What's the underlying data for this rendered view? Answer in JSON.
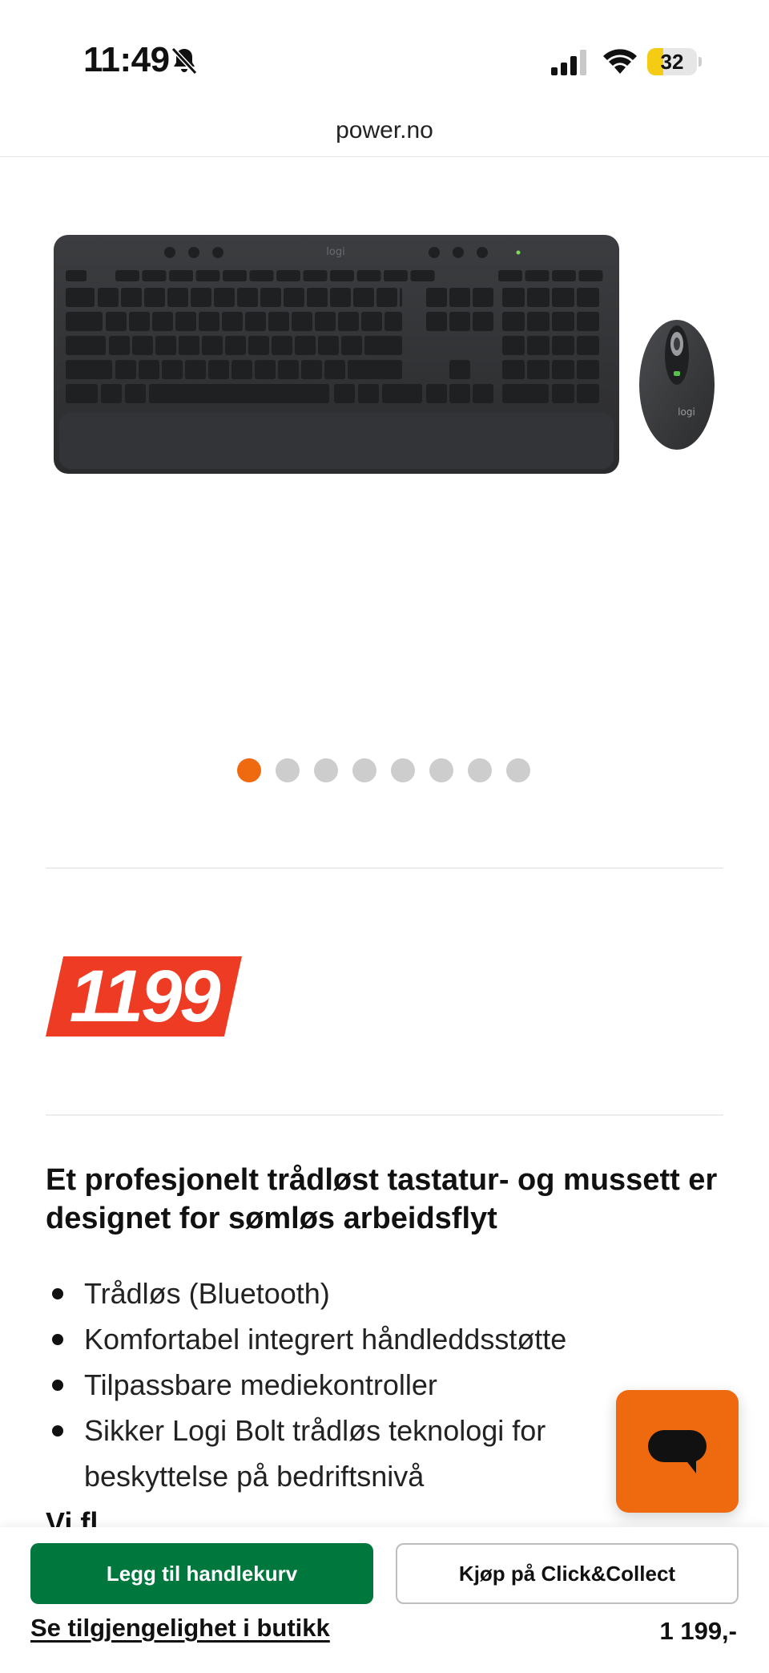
{
  "status_bar": {
    "time": "11:49",
    "battery": "32",
    "battery_level": 0.32,
    "icons": [
      "bell-slash-icon",
      "cellular-signal-icon",
      "wifi-icon",
      "battery-icon"
    ]
  },
  "browser": {
    "url": "power.no"
  },
  "product": {
    "image_brand": "logi",
    "carousel": {
      "count": 8,
      "active_index": 0
    },
    "price_badge": "1199",
    "headline": "Et profesjonelt trådløst tastatur- og mussett er designet for sømløs arbeidsflyt",
    "bullets": [
      "Trådløs (Bluetooth)",
      "Komfortabel integrert håndleddsstøtte",
      "Tilpassbare mediekontroller",
      "Sikker Logi Bolt trådløs teknologi for beskyttelse på bedriftsnivå"
    ],
    "cut_text": "Vi fl..."
  },
  "bottom_bar": {
    "add_to_cart": "Legg til handlekurv",
    "click_collect": "Kjøp på Click&Collect",
    "availability_link": "Se tilgjengelighet i butikk",
    "price": "1 199,-"
  },
  "colors": {
    "accent_orange": "#ef6a0f",
    "price_red": "#ee3b24",
    "cart_green": "#00773d",
    "battery_yellow": "#f5cc14"
  }
}
